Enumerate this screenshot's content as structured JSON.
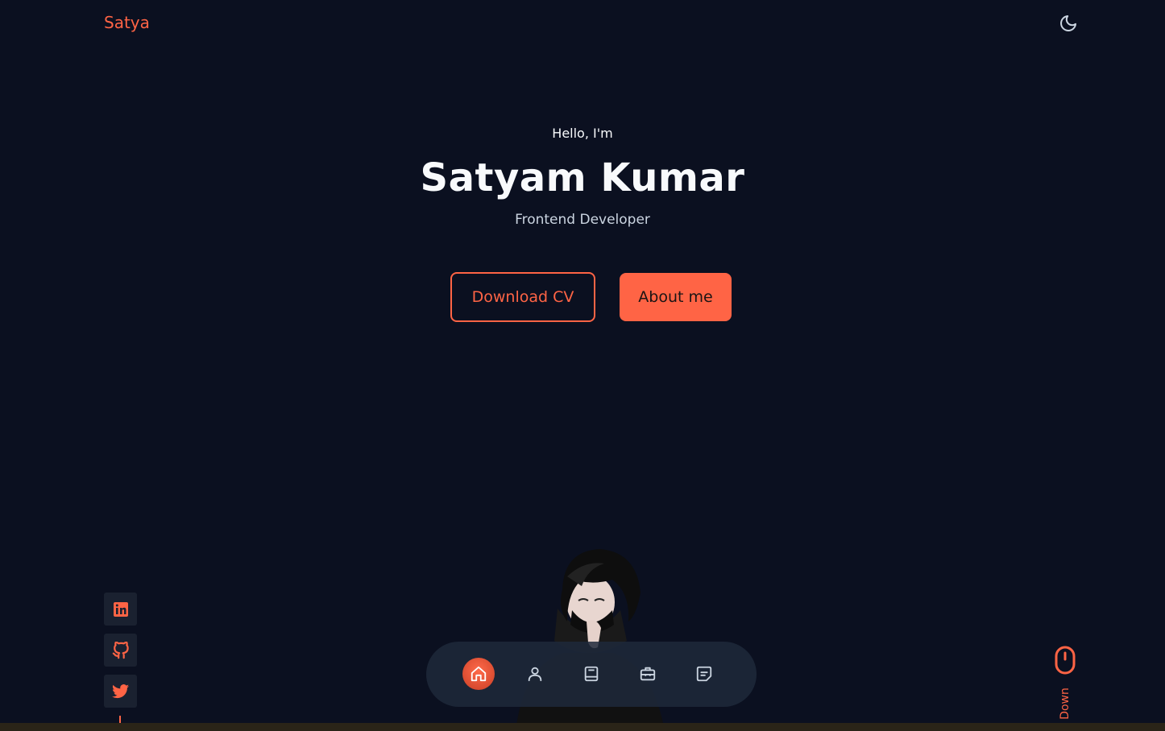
{
  "header": {
    "logo": "Satya",
    "theme_toggle_icon": "moon-icon"
  },
  "hero": {
    "greeting": "Hello, I'm",
    "name": "Satyam Kumar",
    "role": "Frontend Developer",
    "download_cv_label": "Download CV",
    "about_me_label": "About me"
  },
  "socials": [
    {
      "icon": "linkedin-icon"
    },
    {
      "icon": "github-icon"
    },
    {
      "icon": "twitter-icon"
    }
  ],
  "nav": {
    "items": [
      {
        "icon": "home-icon",
        "active": true
      },
      {
        "icon": "user-icon",
        "active": false
      },
      {
        "icon": "book-icon",
        "active": false
      },
      {
        "icon": "briefcase-icon",
        "active": false
      },
      {
        "icon": "message-icon",
        "active": false
      }
    ]
  },
  "scroll": {
    "label": "Down",
    "icon": "mouse-icon"
  },
  "colors": {
    "accent": "#ff6445",
    "background": "#0b1020",
    "nav_background": "#1e293b"
  }
}
